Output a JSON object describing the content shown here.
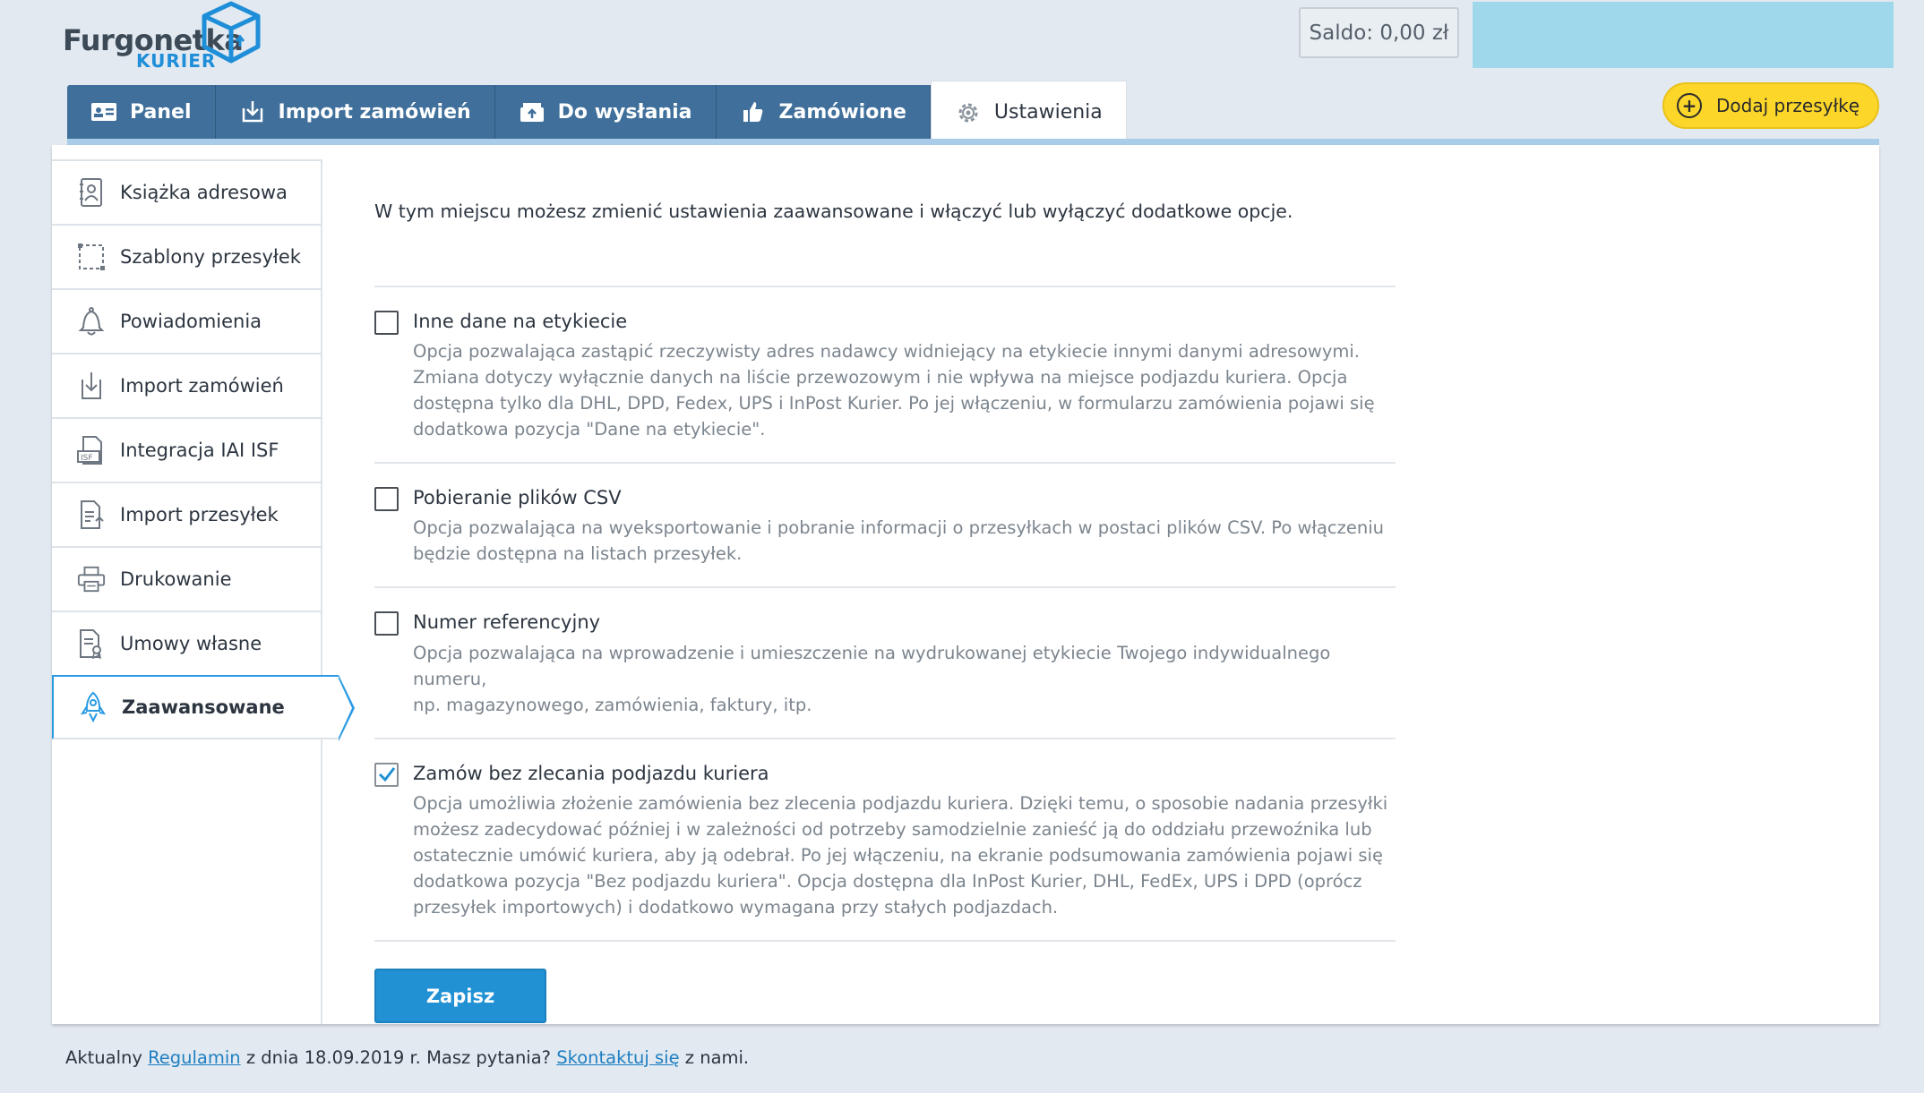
{
  "brand": {
    "name_line1": "Furgonetka",
    "name_line2": "KURIER"
  },
  "header": {
    "saldo": "Saldo: 0,00 zł",
    "add_shipment": "Dodaj przesyłkę"
  },
  "tabs": [
    {
      "label": "Panel",
      "icon": "id-card-icon"
    },
    {
      "label": "Import zamówień",
      "icon": "download-icon"
    },
    {
      "label": "Do wysłania",
      "icon": "outbox-icon"
    },
    {
      "label": "Zamówione",
      "icon": "thumbs-up-icon"
    },
    {
      "label": "Ustawienia",
      "icon": "gear-icon",
      "active": true
    }
  ],
  "sidebar": {
    "items": [
      {
        "label": "Książka adresowa",
        "icon": "address-book-icon"
      },
      {
        "label": "Szablony przesyłek",
        "icon": "template-icon"
      },
      {
        "label": "Powiadomienia",
        "icon": "bell-icon"
      },
      {
        "label": "Import zamówień",
        "icon": "import-icon"
      },
      {
        "label": "Integracja IAI ISF",
        "icon": "isf-file-icon"
      },
      {
        "label": "Import przesyłek",
        "icon": "file-upload-icon"
      },
      {
        "label": "Drukowanie",
        "icon": "printer-icon"
      },
      {
        "label": "Umowy własne",
        "icon": "contract-icon"
      },
      {
        "label": "Zaawansowane",
        "icon": "rocket-icon",
        "active": true
      }
    ]
  },
  "main": {
    "intro": "W tym miejscu możesz zmienić ustawienia zaawansowane i włączyć lub wyłączyć dodatkowe opcje.",
    "options": [
      {
        "title": "Inne dane na etykiecie",
        "checked": false,
        "desc_lines": [
          "Opcja pozwalająca zastąpić rzeczywisty adres nadawcy widniejący na etykiecie innymi danymi adresowymi.",
          "Zmiana dotyczy wyłącznie danych na liście przewozowym i nie wpływa na miejsce podjazdu kuriera. Opcja",
          "dostępna tylko dla DHL, DPD, Fedex, UPS i InPost Kurier. Po jej włączeniu, w formularzu zamówienia pojawi się",
          "dodatkowa pozycja \"Dane na etykiecie\"."
        ]
      },
      {
        "title": "Pobieranie plików CSV",
        "checked": false,
        "desc_lines": [
          "Opcja pozwalająca na wyeksportowanie i pobranie informacji o przesyłkach w postaci plików CSV. Po włączeniu",
          "będzie dostępna na listach przesyłek."
        ]
      },
      {
        "title": "Numer referencyjny",
        "checked": false,
        "desc_lines": [
          "Opcja pozwalająca na wprowadzenie i umieszczenie na wydrukowanej etykiecie Twojego indywidualnego numeru,",
          "np. magazynowego, zamówienia, faktury, itp."
        ]
      },
      {
        "title": "Zamów bez zlecania podjazdu kuriera",
        "checked": true,
        "desc_lines": [
          "Opcja umożliwia złożenie zamówienia bez zlecenia podjazdu kuriera. Dzięki temu, o sposobie nadania przesyłki",
          "możesz zadecydować później i w zależności od potrzeby samodzielnie zanieść ją do oddziału przewoźnika lub",
          "ostatecznie umówić kuriera, aby ją odebrał. Po jej włączeniu, na ekranie podsumowania zamówienia pojawi się",
          "dodatkowa pozycja \"Bez podjazdu kuriera\". Opcja dostępna dla InPost Kurier, DHL, FedEx, UPS i DPD (oprócz",
          "przesyłek importowych) i dodatkowo wymagana przy stałych podjazdach."
        ]
      }
    ],
    "save_label": "Zapisz"
  },
  "footer": {
    "prefix": "Aktualny ",
    "terms_link": "Regulamin",
    "middle": " z dnia 18.09.2019 r. Masz pytania? ",
    "contact_link": "Skontaktuj się",
    "suffix": " z nami."
  },
  "colors": {
    "tab_bg": "#3f6f9a",
    "accent_blue": "#2191d4",
    "add_button": "#fcd72a",
    "page_bg": "#e2e9f0"
  }
}
